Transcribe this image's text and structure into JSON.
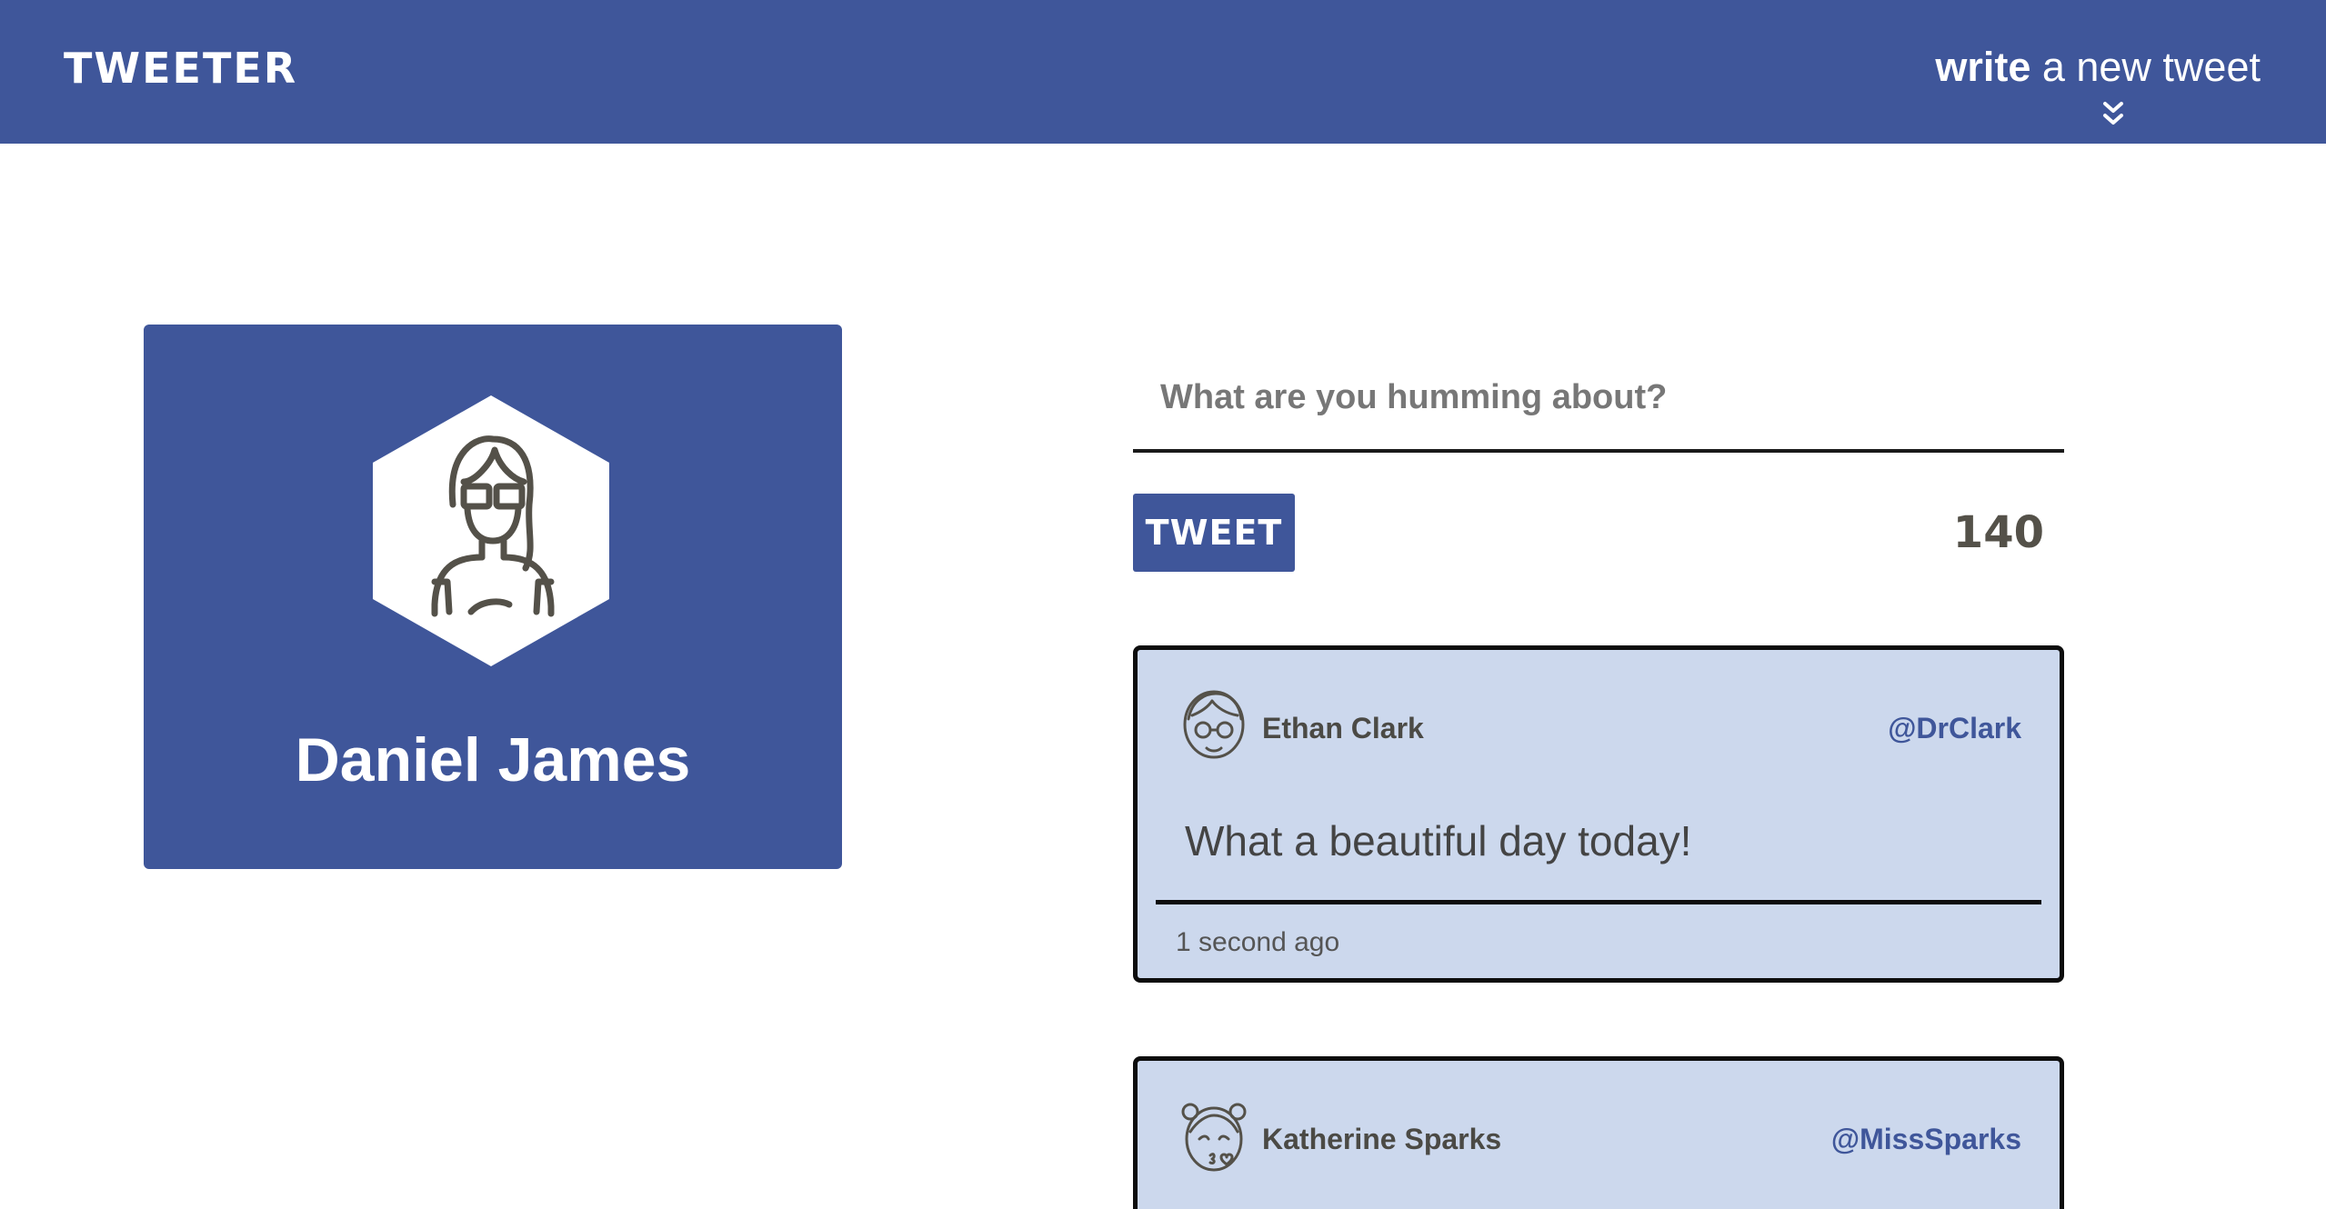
{
  "nav": {
    "brand": "TWEETER",
    "compose_bold": "write",
    "compose_rest": " a new tweet"
  },
  "profile": {
    "name": "Daniel James"
  },
  "composer": {
    "placeholder": "What are you humming about?",
    "button_label": "TWEET",
    "counter": "140"
  },
  "tweets": [
    {
      "name": "Ethan Clark",
      "handle": "@DrClark",
      "text": "What a beautiful day today!",
      "time": "1 second ago"
    },
    {
      "name": "Katherine Sparks",
      "handle": "@MissSparks"
    }
  ],
  "colors": {
    "brand": "#3f569a",
    "tweet_bg": "#ccd8ed",
    "text_dark": "#4b4a45"
  }
}
